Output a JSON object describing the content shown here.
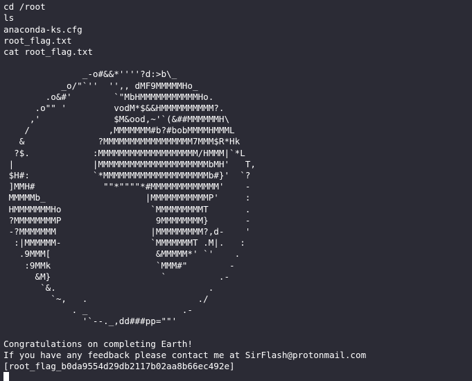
{
  "terminal": {
    "lines": [
      "",
      "cd /root",
      "ls",
      "anaconda-ks.cfg",
      "root_flag.txt",
      "cat root_flag.txt",
      "",
      "               _-o#&&*''''?d:>b\\_",
      "           _o/\"`''  '',, dMF9MMMMMHo_",
      "        .o&#'        `\"MbHMMMMMMMMMMMHo.",
      "      .o\"\" '         vodM*$&&HMMMMMMMMMM?.",
      "     ,'              $M&ood,~'`(&##MMMMMMH\\",
      "    /               ,MMMMMMM#b?#bobMMMMHMMML",
      "   &              ?MMMMMMMMMMMMMMMMM7MMM$R*Hk",
      "  ?$.            :MMMMMMMMMMMMMMMMMMM/HMMM|`*L",
      " |               |MMMMMMMMMMMMMMMMMMMMMbMH'   T,",
      " $H#:            `*MMMMMMMMMMMMMMMMMMMMb#}'  `?",
      " ]MMH#             \"\"*\"\"\"\"*#MMMMMMMMMMMMM'    -",
      " MMMMMb_                   |MMMMMMMMMMMP'     :",
      " HMMMMMMMHo                 `MMMMMMMMMT       .",
      " ?MMMMMMMMP                  9MMMMMMMM}       -",
      " -?MMMMMMM                  |MMMMMMMMM?,d-    '",
      "  :|MMMMMM-                 `MMMMMMMT .M|.   :",
      "   .9MMM[                    &MMMMM*' `'    .",
      "    :9MMk                    `MMM#\"        -",
      "      &M}                     `          .-",
      "       `&.                             .",
      "         `~,   .                     ./",
      "             . _                  .-",
      "               '`--._,dd###pp=\"\"'",
      "",
      "Congratulations on completing Earth!",
      "If you have any feedback please contact me at SirFlash@protonmail.com",
      "[root_flag_b0da9554d29db2117b02aa8b66ec492e]"
    ]
  }
}
